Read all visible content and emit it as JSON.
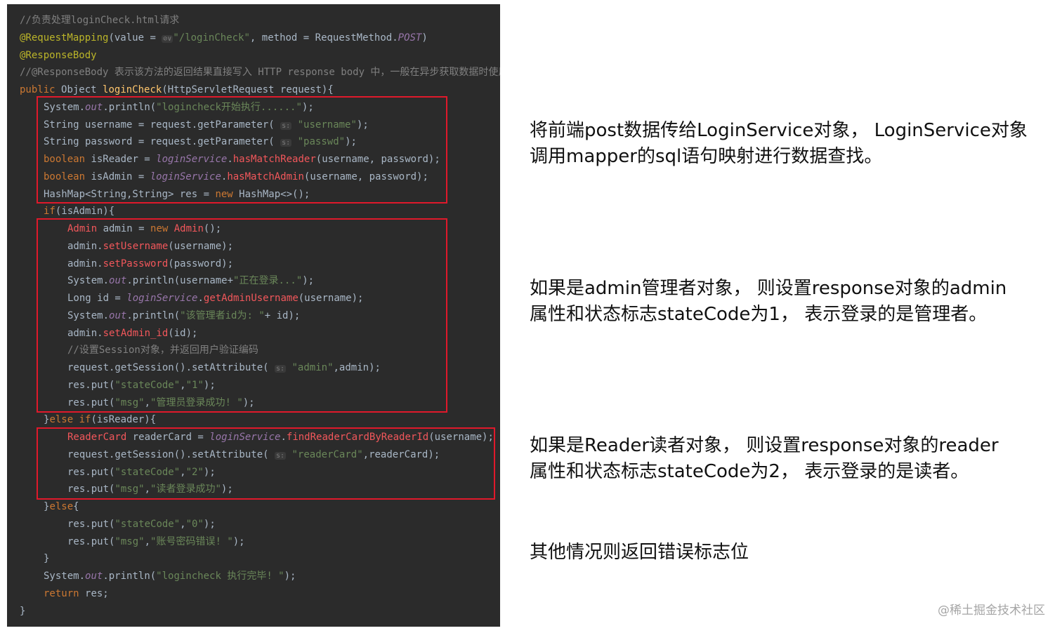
{
  "code": {
    "lines": [
      {
        "indent": 18,
        "segs": [
          {
            "t": "//负责处理loginCheck.html请求",
            "c": "c-comment"
          }
        ]
      },
      {
        "indent": 18,
        "segs": [
          {
            "t": "@RequestMapping",
            "c": "c-anno"
          },
          {
            "t": "(value = ",
            "c": ""
          },
          {
            "t": "⊘∨",
            "c": "c-hint"
          },
          {
            "t": "\"/loginCheck\"",
            "c": "c-str"
          },
          {
            "t": ", method = RequestMethod.",
            "c": ""
          },
          {
            "t": "POST",
            "c": "c-field"
          },
          {
            "t": ")",
            "c": ""
          }
        ]
      },
      {
        "indent": 18,
        "segs": [
          {
            "t": "@ResponseBody",
            "c": "c-anno"
          }
        ]
      },
      {
        "indent": 18,
        "segs": [
          {
            "t": "//@ResponseBody 表示该方法的返回结果直接写入 HTTP response body 中，一般在异步获取数据时使用",
            "c": "c-comment"
          }
        ]
      },
      {
        "indent": 18,
        "segs": [
          {
            "t": "public ",
            "c": "c-kw"
          },
          {
            "t": "Object ",
            "c": ""
          },
          {
            "t": "loginCheck",
            "c": "c-method"
          },
          {
            "t": "(HttpServletRequest request){",
            "c": ""
          }
        ]
      },
      {
        "indent": 52,
        "segs": [
          {
            "t": "System.",
            "c": ""
          },
          {
            "t": "out",
            "c": "c-field"
          },
          {
            "t": ".println(",
            "c": ""
          },
          {
            "t": "\"logincheck开始执行......\"",
            "c": "c-str"
          },
          {
            "t": ");",
            "c": ""
          }
        ]
      },
      {
        "indent": 52,
        "segs": [
          {
            "t": "String username = request.getParameter( ",
            "c": ""
          },
          {
            "t": "s:",
            "c": "c-hint"
          },
          {
            "t": " \"username\"",
            "c": "c-str"
          },
          {
            "t": ");",
            "c": ""
          }
        ]
      },
      {
        "indent": 52,
        "segs": [
          {
            "t": "String password = request.getParameter( ",
            "c": ""
          },
          {
            "t": "s:",
            "c": "c-hint"
          },
          {
            "t": " \"passwd\"",
            "c": "c-str"
          },
          {
            "t": ");",
            "c": ""
          }
        ]
      },
      {
        "indent": 52,
        "segs": [
          {
            "t": "boolean ",
            "c": "c-kw"
          },
          {
            "t": "isReader = ",
            "c": ""
          },
          {
            "t": "loginService",
            "c": "c-field"
          },
          {
            "t": ".",
            "c": ""
          },
          {
            "t": "hasMatchReader",
            "c": "c-red"
          },
          {
            "t": "(username, password);",
            "c": ""
          }
        ]
      },
      {
        "indent": 52,
        "segs": [
          {
            "t": "boolean ",
            "c": "c-kw"
          },
          {
            "t": "isAdmin = ",
            "c": ""
          },
          {
            "t": "loginService",
            "c": "c-field"
          },
          {
            "t": ".",
            "c": ""
          },
          {
            "t": "hasMatchAdmin",
            "c": "c-red"
          },
          {
            "t": "(username, password);",
            "c": ""
          }
        ]
      },
      {
        "indent": 52,
        "segs": [
          {
            "t": "HashMap<String,String> res = ",
            "c": ""
          },
          {
            "t": "new ",
            "c": "c-kw"
          },
          {
            "t": "HashMap<>();",
            "c": ""
          }
        ]
      },
      {
        "indent": 52,
        "segs": [
          {
            "t": "if",
            "c": "c-kw"
          },
          {
            "t": "(isAdmin){",
            "c": ""
          }
        ]
      },
      {
        "indent": 86,
        "segs": [
          {
            "t": "Admin ",
            "c": "c-red"
          },
          {
            "t": "admin = ",
            "c": ""
          },
          {
            "t": "new ",
            "c": "c-kw"
          },
          {
            "t": "Admin",
            "c": "c-red"
          },
          {
            "t": "();",
            "c": ""
          }
        ]
      },
      {
        "indent": 86,
        "segs": [
          {
            "t": "admin.",
            "c": ""
          },
          {
            "t": "setUsername",
            "c": "c-red"
          },
          {
            "t": "(username);",
            "c": ""
          }
        ]
      },
      {
        "indent": 86,
        "segs": [
          {
            "t": "admin.",
            "c": ""
          },
          {
            "t": "setPassword",
            "c": "c-red"
          },
          {
            "t": "(password);",
            "c": ""
          }
        ]
      },
      {
        "indent": 86,
        "segs": [
          {
            "t": "System.",
            "c": ""
          },
          {
            "t": "out",
            "c": "c-field"
          },
          {
            "t": ".println(username+",
            "c": ""
          },
          {
            "t": "\"正在登录...\"",
            "c": "c-str"
          },
          {
            "t": ");",
            "c": ""
          }
        ]
      },
      {
        "indent": 86,
        "segs": [
          {
            "t": "Long id = ",
            "c": ""
          },
          {
            "t": "loginService",
            "c": "c-field"
          },
          {
            "t": ".",
            "c": ""
          },
          {
            "t": "getAdminUsername",
            "c": "c-red"
          },
          {
            "t": "(username);",
            "c": ""
          }
        ]
      },
      {
        "indent": 86,
        "segs": [
          {
            "t": "System.",
            "c": ""
          },
          {
            "t": "out",
            "c": "c-field"
          },
          {
            "t": ".println(",
            "c": ""
          },
          {
            "t": "\"该管理者id为: \"",
            "c": "c-str"
          },
          {
            "t": "+ id);",
            "c": ""
          }
        ]
      },
      {
        "indent": 86,
        "segs": [
          {
            "t": "admin.",
            "c": ""
          },
          {
            "t": "setAdmin_id",
            "c": "c-red"
          },
          {
            "t": "(id);",
            "c": ""
          }
        ]
      },
      {
        "indent": 86,
        "segs": [
          {
            "t": "//设置Session对象，并返回用户验证编码",
            "c": "c-comment"
          }
        ]
      },
      {
        "indent": 86,
        "segs": [
          {
            "t": "request.getSession().setAttribute( ",
            "c": ""
          },
          {
            "t": "s:",
            "c": "c-hint"
          },
          {
            "t": " \"admin\"",
            "c": "c-str"
          },
          {
            "t": ",admin);",
            "c": ""
          }
        ]
      },
      {
        "indent": 86,
        "segs": [
          {
            "t": "res.put(",
            "c": ""
          },
          {
            "t": "\"stateCode\"",
            "c": "c-str"
          },
          {
            "t": ",",
            "c": ""
          },
          {
            "t": "\"1\"",
            "c": "c-str"
          },
          {
            "t": ");",
            "c": ""
          }
        ]
      },
      {
        "indent": 86,
        "segs": [
          {
            "t": "res.put(",
            "c": ""
          },
          {
            "t": "\"msg\"",
            "c": "c-str"
          },
          {
            "t": ",",
            "c": ""
          },
          {
            "t": "\"管理员登录成功! \"",
            "c": "c-str"
          },
          {
            "t": ");",
            "c": ""
          }
        ]
      },
      {
        "indent": 52,
        "segs": [
          {
            "t": "}",
            "c": ""
          },
          {
            "t": "else if",
            "c": "c-kw"
          },
          {
            "t": "(isReader){",
            "c": ""
          }
        ]
      },
      {
        "indent": 86,
        "segs": [
          {
            "t": "ReaderCard ",
            "c": "c-red"
          },
          {
            "t": "readerCard = ",
            "c": ""
          },
          {
            "t": "loginService",
            "c": "c-field"
          },
          {
            "t": ".",
            "c": ""
          },
          {
            "t": "findReaderCardByReaderId",
            "c": "c-red"
          },
          {
            "t": "(username);",
            "c": ""
          }
        ]
      },
      {
        "indent": 86,
        "segs": [
          {
            "t": "request.getSession().setAttribute( ",
            "c": ""
          },
          {
            "t": "s:",
            "c": "c-hint"
          },
          {
            "t": " \"readerCard\"",
            "c": "c-str"
          },
          {
            "t": ",readerCard);",
            "c": ""
          }
        ]
      },
      {
        "indent": 86,
        "segs": [
          {
            "t": "res.put(",
            "c": ""
          },
          {
            "t": "\"stateCode\"",
            "c": "c-str"
          },
          {
            "t": ",",
            "c": ""
          },
          {
            "t": "\"2\"",
            "c": "c-str"
          },
          {
            "t": ");",
            "c": ""
          }
        ]
      },
      {
        "indent": 86,
        "segs": [
          {
            "t": "res.put(",
            "c": ""
          },
          {
            "t": "\"msg\"",
            "c": "c-str"
          },
          {
            "t": ",",
            "c": ""
          },
          {
            "t": "\"读者登录成功\"",
            "c": "c-str"
          },
          {
            "t": ");",
            "c": ""
          }
        ]
      },
      {
        "indent": 52,
        "segs": [
          {
            "t": "}",
            "c": ""
          },
          {
            "t": "else",
            "c": "c-kw"
          },
          {
            "t": "{",
            "c": ""
          }
        ]
      },
      {
        "indent": 86,
        "segs": [
          {
            "t": "res.put(",
            "c": ""
          },
          {
            "t": "\"stateCode\"",
            "c": "c-str"
          },
          {
            "t": ",",
            "c": ""
          },
          {
            "t": "\"0\"",
            "c": "c-str"
          },
          {
            "t": ");",
            "c": ""
          }
        ]
      },
      {
        "indent": 86,
        "segs": [
          {
            "t": "res.put(",
            "c": ""
          },
          {
            "t": "\"msg\"",
            "c": "c-str"
          },
          {
            "t": ",",
            "c": ""
          },
          {
            "t": "\"账号密码错误! \"",
            "c": "c-str"
          },
          {
            "t": ");",
            "c": ""
          }
        ]
      },
      {
        "indent": 52,
        "segs": [
          {
            "t": "}",
            "c": ""
          }
        ]
      },
      {
        "indent": 52,
        "segs": [
          {
            "t": "System.",
            "c": ""
          },
          {
            "t": "out",
            "c": "c-field"
          },
          {
            "t": ".println(",
            "c": ""
          },
          {
            "t": "\"logincheck 执行完毕! \"",
            "c": "c-str"
          },
          {
            "t": ");",
            "c": ""
          }
        ]
      },
      {
        "indent": 52,
        "segs": [
          {
            "t": "return ",
            "c": "c-kw"
          },
          {
            "t": "res;",
            "c": ""
          }
        ]
      },
      {
        "indent": 18,
        "segs": [
          {
            "t": "}",
            "c": ""
          }
        ]
      }
    ]
  },
  "annotations": {
    "block1": {
      "line1": "将前端post数据传给LoginService对象， LoginService对象",
      "line2": "调用mapper的sql语句映射进行数据查找。"
    },
    "block2": {
      "line1": "如果是admin管理者对象， 则设置response对象的admin",
      "line2": "属性和状态标志stateCode为1， 表示登录的是管理者。"
    },
    "block3": {
      "line1": "如果是Reader读者对象， 则设置response对象的reader",
      "line2": "属性和状态标志stateCode为2， 表示登录的是读者。"
    },
    "block4": {
      "line1": "其他情况则返回错误标志位"
    }
  },
  "watermark": "@稀土掘金技术社区"
}
